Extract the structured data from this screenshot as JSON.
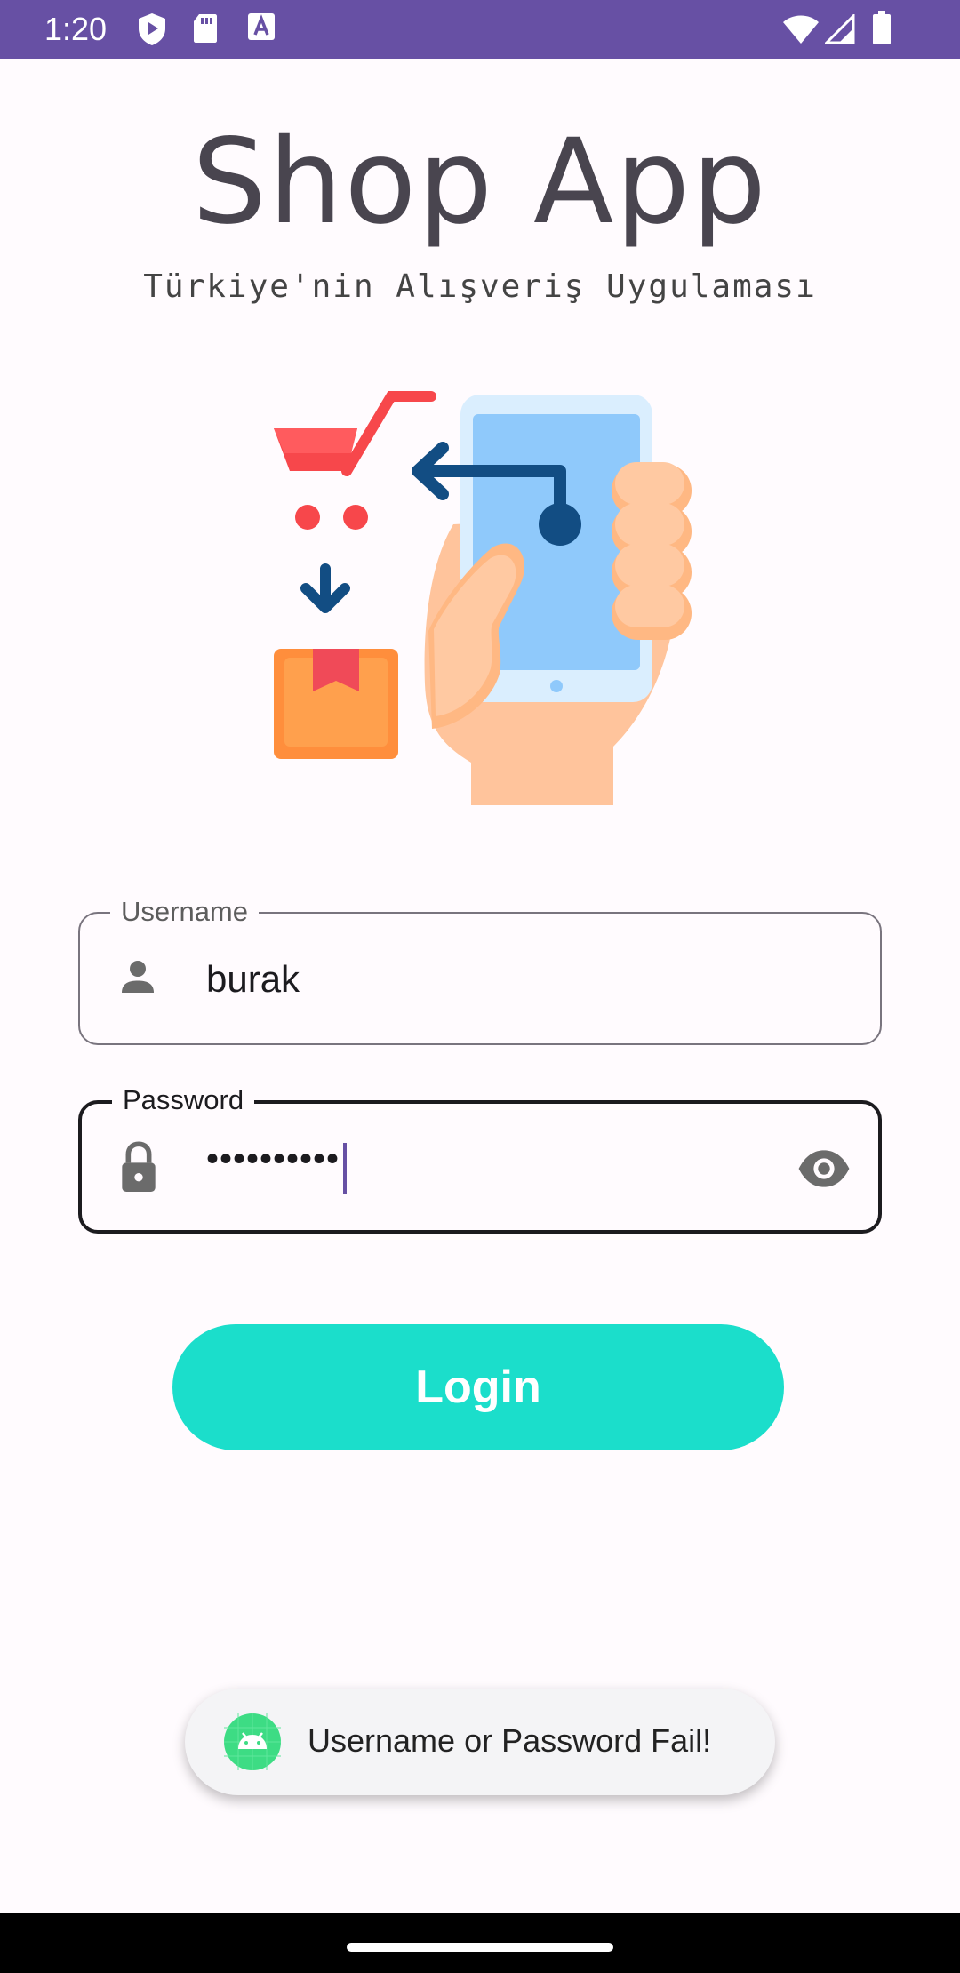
{
  "status_bar": {
    "time": "1:20",
    "background": "#6750a4",
    "icons": [
      "shield-play-icon",
      "sd-card-icon",
      "font-a-icon",
      "wifi-icon",
      "signal-icon",
      "battery-icon"
    ]
  },
  "header": {
    "title": "Shop App",
    "subtitle": "Türkiye'nin Alışveriş Uygulaması"
  },
  "illustration": {
    "icon": "shopping-cart-phone-illustration"
  },
  "form": {
    "username": {
      "label": "Username",
      "value": "burak",
      "icon": "person-icon"
    },
    "password": {
      "label": "Password",
      "value": "••••••••••",
      "icon": "lock-icon",
      "toggle_icon": "eye-icon"
    },
    "login_label": "Login",
    "accent": "#1bdecb"
  },
  "toast": {
    "message": "Username or Password Fail!",
    "icon": "android-icon"
  }
}
